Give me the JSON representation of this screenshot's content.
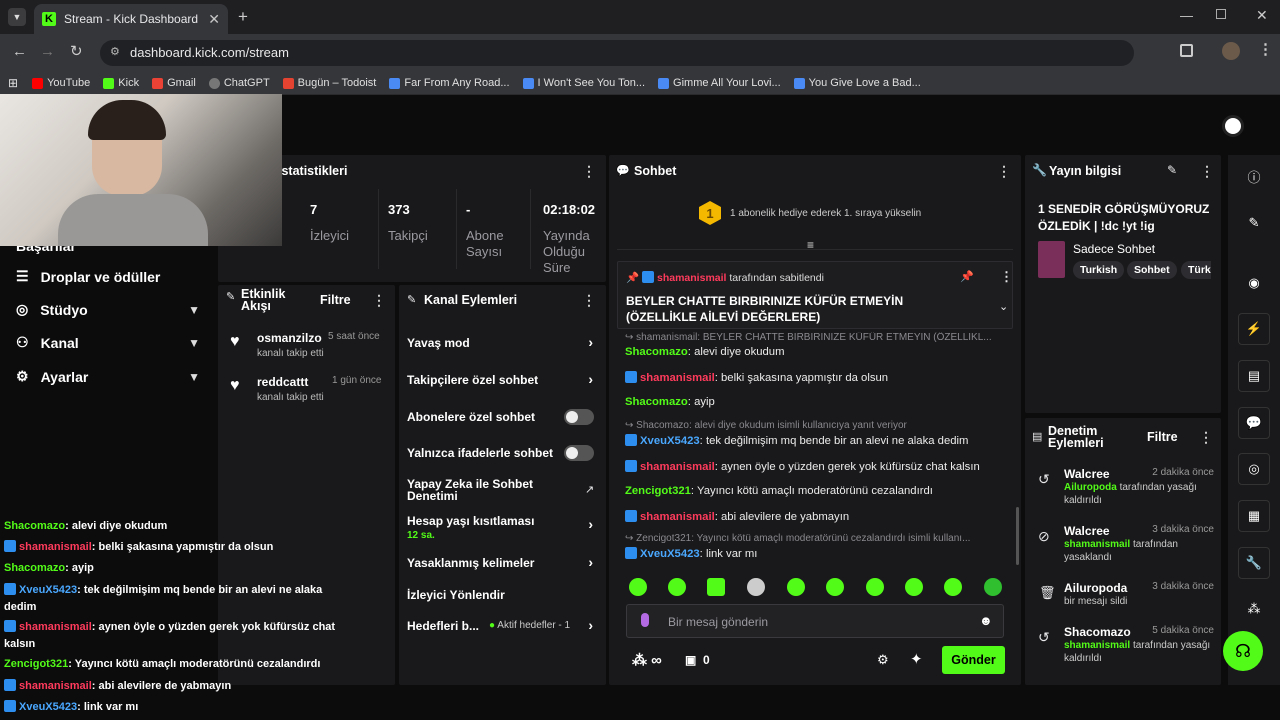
{
  "browser": {
    "tab_title": "Stream - Kick Dashboard",
    "url": "dashboard.kick.com/stream",
    "bookmarks": [
      "YouTube",
      "Kick",
      "Gmail",
      "ChatGPT",
      "Bugün – Todoist",
      "Far From Any Road...",
      "I Won't See You Ton...",
      "Gimme All Your Lovi...",
      "You Give Love a Bad..."
    ]
  },
  "sidebar": {
    "partial_item": "Başarılar",
    "items": [
      {
        "label": "Droplar ve ödüller",
        "chevron": false
      },
      {
        "label": "Stüdyo",
        "chevron": true
      },
      {
        "label": "Kanal",
        "chevron": true
      },
      {
        "label": "Ayarlar",
        "chevron": true
      }
    ]
  },
  "stats": {
    "title": "İstatistikleri",
    "viewers_value": "7",
    "viewers_label": "İzleyici",
    "followers_value": "373",
    "followers_label": "Takipçi",
    "subs_value": "-",
    "subs_label": "Abone Sayısı",
    "duration_value": "02:18:02",
    "duration_label": "Yayında Olduğu Süre"
  },
  "activity": {
    "title": "Etkinlik Akışı",
    "filter": "Filtre",
    "items": [
      {
        "user": "osmanzilzo",
        "time": "5 saat önce",
        "desc": "kanalı takip etti"
      },
      {
        "user": "reddcattt",
        "time": "1 gün önce",
        "desc": "kanalı takip etti"
      }
    ]
  },
  "channel_actions": {
    "title": "Kanal Eylemleri",
    "slow_mode": "Yavaş mod",
    "followers_only": "Takipçilere özel sohbet",
    "subs_only": "Abonelere özel sohbet",
    "emote_only": "Yalnızca ifadelerle sohbet",
    "ai_mod": "Yapay Zeka ile Sohbet Denetimi",
    "account_age": "Hesap yaşı kısıtlaması",
    "account_age_value": "12 sa.",
    "banned_words": "Yasaklanmış kelimeler",
    "redirect": "İzleyici Yönlendir",
    "goals": "Hedefleri b...",
    "goals_status": "Aktif hedefler - 1"
  },
  "chat": {
    "title": "Sohbet",
    "gift_banner": "1 abonelik hediye ederek 1. sıraya yükselin",
    "gift_rank": "1",
    "pinned_by_user": "shamanismail",
    "pinned_by_suffix": "tarafından sabitlendi",
    "pinned_text": "BEYLER CHATTE BIRBIRINIZE KÜFÜR ETMEYİN (ÖZELLİKLE AİLEVİ DEĞERLERE)",
    "reply1": "shamanismail: BEYLER CHATTE BIRBIRINIZE KÜFÜR ETMEYİN (ÖZELLİKL...",
    "msg1_user": "Shacomazo",
    "msg1_text": "alevi diye okudum",
    "msg2_user": "shamanismail",
    "msg2_text": "belki şakasına yapmıştır da olsun",
    "msg3_user": "Shacomazo",
    "msg3_text": "ayip",
    "reply2": "Shacomazo: alevi diye okudum isimli kullanıcıya yanıt veriyor",
    "msg4_user": "XveuX5423",
    "msg4_text": "tek değilmişim mq bende bir an alevi ne alaka dedim",
    "msg5_user": "shamanismail",
    "msg5_text": "aynen öyle o yüzden gerek yok küfürsüz chat kalsın",
    "msg6_user": "Zencigot321",
    "msg6_text": "Yayıncı kötü amaçlı moderatörünü cezalandırdı",
    "msg7_user": "shamanismail",
    "msg7_text": "abi alevilere de yabmayın",
    "reply3": "Zencigot321: Yayıncı kötü amaçlı moderatörünü cezalandırdı isimli kullanı...",
    "msg8_user": "XveuX5423",
    "msg8_text": "link var mı",
    "input_placeholder": "Bir mesaj gönderin",
    "points": "∞",
    "chest_count": "0",
    "send": "Gönder"
  },
  "stream_info": {
    "title": "Yayın bilgisi",
    "stream_title": "1 SENEDİR GÖRÜŞMÜYORUZ ÖZLEDİK | !dc !yt !ig",
    "category": "Sadece Sohbet",
    "tags": [
      "Turkish",
      "Sohbet",
      "Türk"
    ]
  },
  "moderation": {
    "title": "Denetim Eylemleri",
    "filter": "Filtre",
    "items": [
      {
        "user": "Walcree",
        "time": "2 dakika önce",
        "target": "Ailuropoda",
        "desc": "tarafından yasağı kaldırıldı",
        "icon": "unban-icon"
      },
      {
        "user": "Walcree",
        "time": "3 dakika önce",
        "target": "shamanismail",
        "desc": "tarafından yasaklandı",
        "icon": "ban-icon"
      },
      {
        "user": "Ailuropoda",
        "time": "3 dakika önce",
        "target": "",
        "desc": "bir mesajı sildi",
        "icon": "trash-icon"
      },
      {
        "user": "Shacomazo",
        "time": "5 dakika önce",
        "target": "shamanismail",
        "desc": "tarafından yasağı kaldırıldı",
        "icon": "unban-icon"
      }
    ]
  },
  "overlay_chat": [
    {
      "user": "Shacomazo",
      "text": "alevi diye okudum",
      "color": "green"
    },
    {
      "user": "shamanismail",
      "text": "belki şakasına yapmıştır da olsun",
      "color": "red"
    },
    {
      "user": "Shacomazo",
      "text": "ayip",
      "color": "green"
    },
    {
      "user": "XveuX5423",
      "text": "tek değilmişim mq bende bir an alevi ne alaka dedim",
      "color": "blue"
    },
    {
      "user": "shamanismail",
      "text": "aynen öyle o yüzden gerek yok küfürsüz chat kalsın",
      "color": "red"
    },
    {
      "user": "Zencigot321",
      "text": "Yayıncı kötü amaçlı moderatörünü cezalandırdı",
      "color": "green"
    },
    {
      "user": "shamanismail",
      "text": "abi alevilere de yabmayın",
      "color": "red"
    },
    {
      "user": "XveuX5423",
      "text": "link var mı",
      "color": "blue"
    }
  ],
  "colors": {
    "accent": "#53fc18",
    "card": "#19191b",
    "bg": "#0c0c0d",
    "red_user": "#ff3b5c",
    "blue_user": "#4aa8ff"
  }
}
